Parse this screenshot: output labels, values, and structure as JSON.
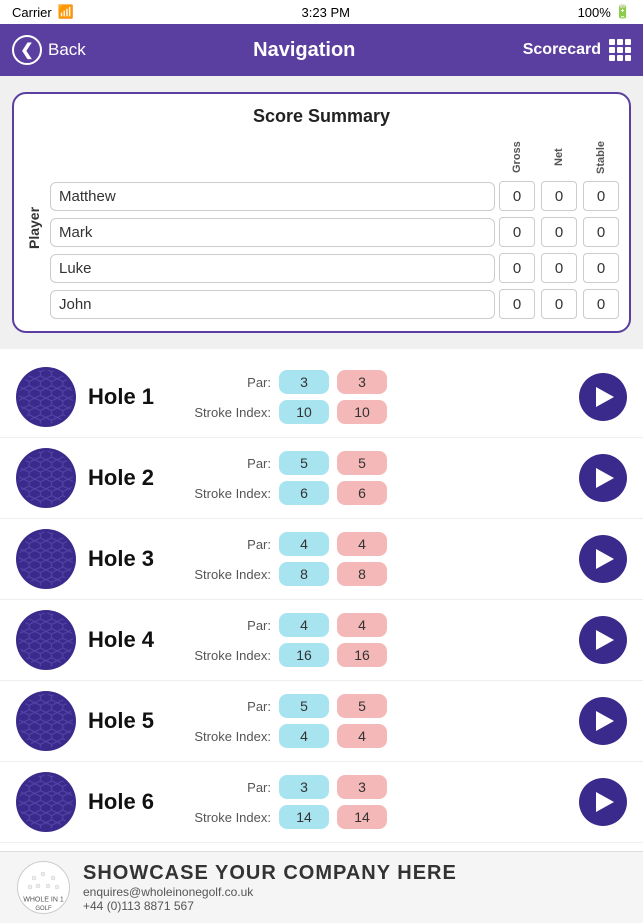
{
  "statusBar": {
    "carrier": "Carrier",
    "time": "3:23 PM",
    "signal": "100%"
  },
  "navBar": {
    "backLabel": "Back",
    "title": "Navigation",
    "scorecardLabel": "Scorecard"
  },
  "scoreSummary": {
    "title": "Score Summary",
    "playerLabel": "Player",
    "columnHeaders": [
      "Gross",
      "Net",
      "Stable"
    ],
    "players": [
      {
        "name": "Matthew",
        "gross": "0",
        "net": "0",
        "stable": "0"
      },
      {
        "name": "Mark",
        "gross": "0",
        "net": "0",
        "stable": "0"
      },
      {
        "name": "Luke",
        "gross": "0",
        "net": "0",
        "stable": "0"
      },
      {
        "name": "John",
        "gross": "0",
        "net": "0",
        "stable": "0"
      }
    ]
  },
  "holes": [
    {
      "name": "Hole 1",
      "par": "3",
      "strokeIndex": "10"
    },
    {
      "name": "Hole 2",
      "par": "5",
      "strokeIndex": "6"
    },
    {
      "name": "Hole 3",
      "par": "4",
      "strokeIndex": "8"
    },
    {
      "name": "Hole 4",
      "par": "4",
      "strokeIndex": "16"
    },
    {
      "name": "Hole 5",
      "par": "5",
      "strokeIndex": "4"
    },
    {
      "name": "Hole 6",
      "par": "3",
      "strokeIndex": "14"
    }
  ],
  "labels": {
    "par": "Par:",
    "strokeIndex": "Stroke Index:"
  },
  "footer": {
    "showcase": "SHOWCASE YOUR COMPANY HERE",
    "email": "enquires@wholeinonegolf.co.uk",
    "phone": "+44 (0)113 8871 567"
  }
}
